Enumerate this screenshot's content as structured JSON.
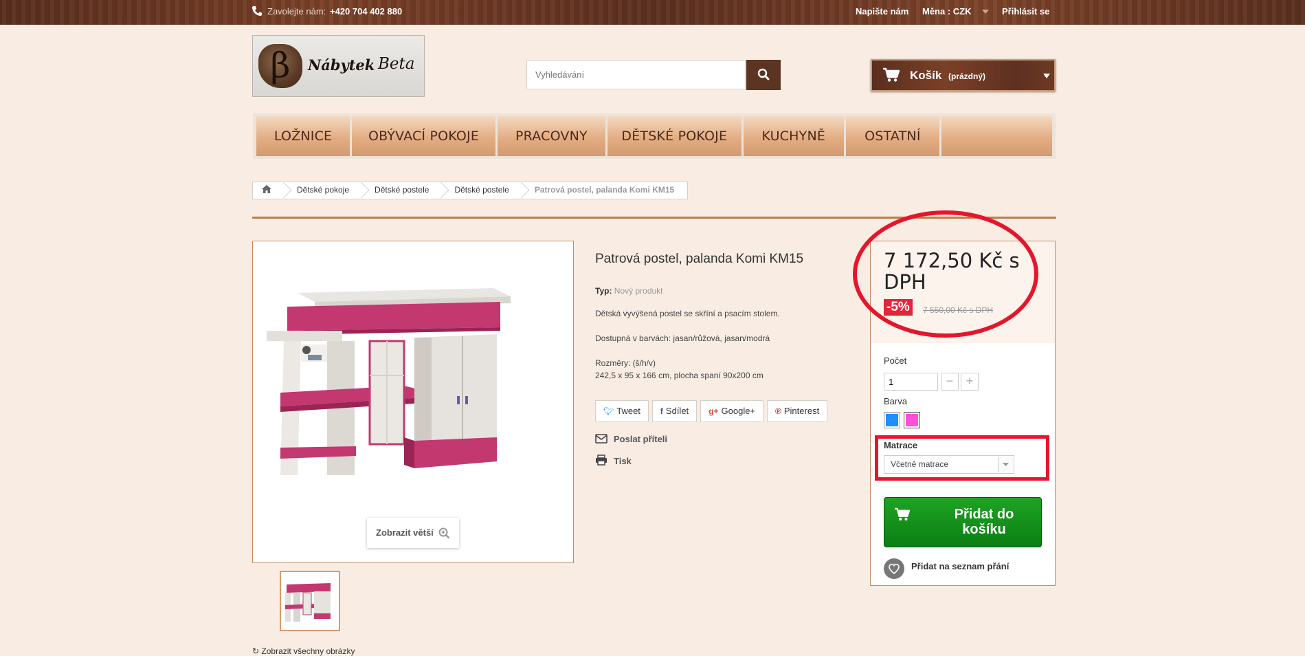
{
  "topbar": {
    "call_label": "Zavolejte nám:",
    "phone": "+420 704 402 880",
    "contact_link": "Napište nám",
    "currency_label": "Měna : CZK",
    "login_link": "Přihlásit se"
  },
  "header": {
    "logo_mark": "β",
    "logo_word": "Nábytek",
    "logo_beta": "Beta",
    "search_placeholder": "Vyhledávání",
    "cart_label": "Košík",
    "cart_status": "(prázdný)"
  },
  "menu": {
    "items": [
      {
        "label": "Ložnice"
      },
      {
        "label": "Obývací pokoje"
      },
      {
        "label": "Pracovny"
      },
      {
        "label": "Dětské pokoje"
      },
      {
        "label": "Kuchyně"
      },
      {
        "label": "Ostatní"
      },
      {
        "label": ""
      }
    ]
  },
  "breadcrumb": {
    "items": [
      "Dětské pokoje",
      "Dětské postele",
      "Dětské postele"
    ],
    "current": "Patrová postel, palanda Komi KM15"
  },
  "product": {
    "zoom_label": "Zobrazit větší",
    "show_all_images": "Zobrazit všechny obrázky",
    "title": "Patrová postel, palanda Komi KM15",
    "type_label": "Typ:",
    "type_value": "Nový produkt",
    "description": "Dětská vyvýšená postel se skříní a psacím stolem.",
    "colors_line": "Dostupná v barvách: jasan/růžová, jasan/modrá",
    "dimensions_label": "Rozměry: (š/h/v)",
    "dimensions_value": "242,5 x 95 x 166 cm, plocha spaní 90x200 cm",
    "social": {
      "tweet": "Tweet",
      "share": "Sdílet",
      "google": "Google+",
      "pinterest": "Pinterest"
    },
    "send_to_friend": "Poslat příteli",
    "print": "Tisk"
  },
  "buy": {
    "price": "7 172,50 Kč s DPH",
    "discount": "-5%",
    "old_price": "7 550,00 Kč s DPH",
    "quantity_label": "Počet",
    "quantity_value": "1",
    "color_label": "Barva",
    "swatches": [
      {
        "name": "modrá",
        "color": "#1e90ff"
      },
      {
        "name": "růžová",
        "color": "#ff4fd8"
      }
    ],
    "mattress_label": "Matrace",
    "mattress_value": "Včetně matrace",
    "add_to_cart": "Přidat do košíku",
    "wishlist": "Přidat na seznam přání"
  },
  "colors": {
    "accent_brown": "#5b3422",
    "highlight_red": "#e5162c",
    "cart_green": "#1a9a20"
  }
}
